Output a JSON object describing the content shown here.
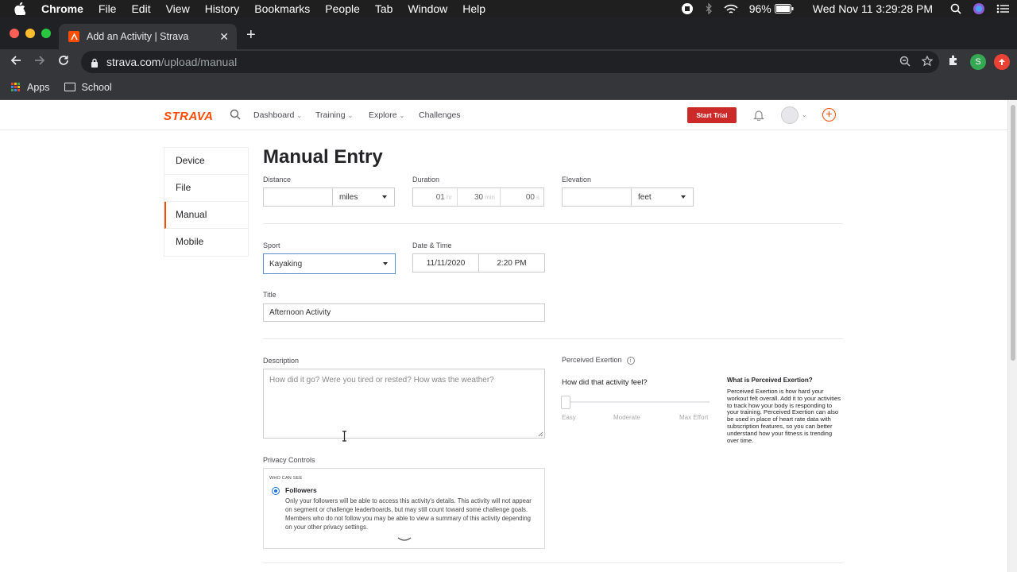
{
  "menubar": {
    "app": "Chrome",
    "items": [
      "File",
      "Edit",
      "View",
      "History",
      "Bookmarks",
      "People",
      "Tab",
      "Window",
      "Help"
    ],
    "battery": "96%",
    "datetime": "Wed Nov 11  3:29:28 PM"
  },
  "browser": {
    "tab_title": "Add an Activity | Strava",
    "url_host": "strava.com",
    "url_path": "/upload/manual",
    "extension_initial": "S",
    "bookmarks": [
      "Apps",
      "School"
    ]
  },
  "nav": {
    "logo": "STRAVA",
    "links": [
      "Dashboard",
      "Training",
      "Explore",
      "Challenges"
    ],
    "trial_button": "Start Trial"
  },
  "sidemenu": {
    "items": [
      "Device",
      "File",
      "Manual",
      "Mobile"
    ],
    "active": "Manual"
  },
  "form": {
    "heading": "Manual Entry",
    "distance": {
      "label": "Distance",
      "value": "",
      "unit": "miles"
    },
    "duration": {
      "label": "Duration",
      "hours": "01",
      "hours_unit": "hr",
      "minutes": "30",
      "minutes_unit": "min",
      "seconds": "00",
      "seconds_unit": "s"
    },
    "elevation": {
      "label": "Elevation",
      "value": "",
      "unit": "feet"
    },
    "sport": {
      "label": "Sport",
      "value": "Kayaking"
    },
    "datetime": {
      "label": "Date & Time",
      "date": "11/11/2020",
      "time": "2:20 PM"
    },
    "title": {
      "label": "Title",
      "value": "Afternoon Activity"
    },
    "description": {
      "label": "Description",
      "placeholder": "How did it go? Were you tired or rested? How was the weather?"
    },
    "exertion": {
      "label": "Perceived Exertion",
      "question": "How did that activity feel?",
      "level": 0,
      "scale": [
        "Easy",
        "Moderate",
        "Max Effort"
      ],
      "info_title": "What is Perceived Exertion?",
      "info_text": "Perceived Exertion is how hard your workout felt overall. Add it to your activities to track how your body is responding to your training. Perceived Exertion can also be used in place of heart rate data with subscription features, so you can better understand how your fitness is trending over time."
    },
    "privacy": {
      "label": "Privacy Controls",
      "who_can_see": "WHO CAN SEE",
      "selected": "Followers",
      "description": "Only your followers will be able to access this activity's details. This activity will not appear on segment or challenge leaderboards, but may still count toward some challenge goals. Members who do not follow you may be able to view a summary of this activity depending on your other privacy settings."
    }
  },
  "colors": {
    "strava_orange": "#fc4c02",
    "trial_red": "#cc2929",
    "radio_blue": "#1e73e8"
  }
}
